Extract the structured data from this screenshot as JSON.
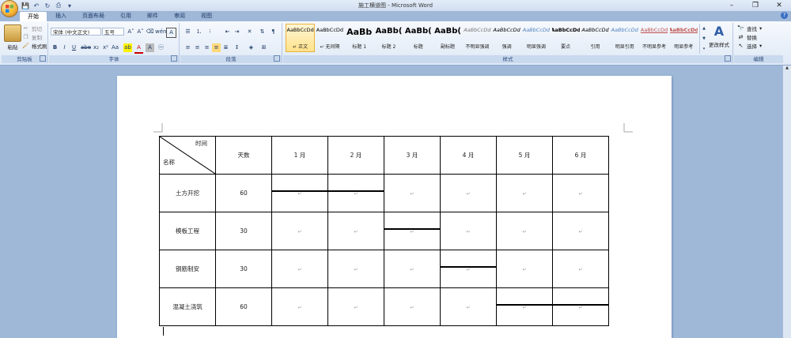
{
  "window": {
    "title": "施工横道图 - Microsoft Word",
    "controls": [
      "–",
      "❐",
      "✕"
    ]
  },
  "tabs": [
    {
      "label": "开始",
      "active": true
    },
    {
      "label": "插入"
    },
    {
      "label": "页面布局"
    },
    {
      "label": "引用"
    },
    {
      "label": "邮件"
    },
    {
      "label": "审阅"
    },
    {
      "label": "视图"
    }
  ],
  "ribbon": {
    "clipboard": {
      "paste": "粘贴",
      "cut": "剪切",
      "copy": "复制",
      "format_painter": "格式刷",
      "label": "剪贴板"
    },
    "font": {
      "font_name": "宋体 (中文正文)",
      "font_size": "五号",
      "label": "字体"
    },
    "paragraph": {
      "label": "段落"
    },
    "styles": {
      "label": "样式",
      "items": [
        {
          "preview": "AaBbCcDd",
          "name": "↵ 正文",
          "selected": true
        },
        {
          "preview": "AaBbCcDd",
          "name": "↵ 无间隔"
        },
        {
          "preview": "AaBb",
          "name": "标题 1"
        },
        {
          "preview": "AaBb(",
          "name": "标题 2"
        },
        {
          "preview": "AaBb(",
          "name": "标题"
        },
        {
          "preview": "AaBb(",
          "name": "副标题"
        },
        {
          "preview": "AaBbCcDd",
          "name": "不明显强调"
        },
        {
          "preview": "AaBbCcDd",
          "name": "强调"
        },
        {
          "preview": "AaBbCcDd",
          "name": "明显强调"
        },
        {
          "preview": "AaBbCcDd",
          "name": "要点"
        },
        {
          "preview": "AaBbCcDd",
          "name": "引用"
        },
        {
          "preview": "AaBbCcDd",
          "name": "明显引用"
        },
        {
          "preview": "AaBbCcDd",
          "name": "不明显参考"
        },
        {
          "preview": "AaBbCcDd",
          "name": "明显参考"
        }
      ],
      "change_styles": "更改样式"
    },
    "editing": {
      "find": "查找",
      "replace": "替换",
      "select": "选择",
      "label": "编辑"
    }
  },
  "document": {
    "table": {
      "header_time": "时间",
      "header_name": "名称",
      "columns": [
        "天数",
        "1 月",
        "2 月",
        "3 月",
        "4 月",
        "5 月",
        "6 月"
      ],
      "rows": [
        {
          "name": "土方开挖",
          "days": "60",
          "bar_start_month": 1,
          "bar_span_months": 2
        },
        {
          "name": "模板工程",
          "days": "30",
          "bar_start_month": 3,
          "bar_span_months": 1
        },
        {
          "name": "钢筋制安",
          "days": "30",
          "bar_start_month": 4,
          "bar_span_months": 1
        },
        {
          "name": "混凝土浇筑",
          "days": "60",
          "bar_start_month": 5,
          "bar_span_months": 2
        }
      ]
    }
  }
}
